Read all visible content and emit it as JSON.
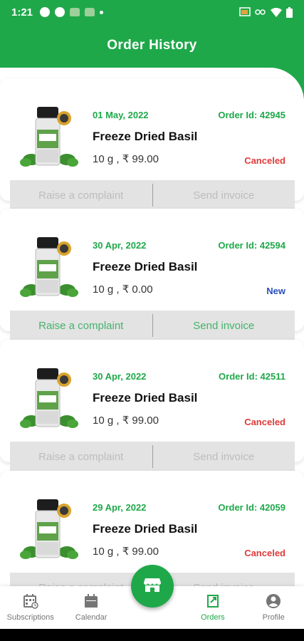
{
  "status_bar": {
    "time": "1:21",
    "left_icons": [
      "chrome-icon",
      "play-icon",
      "android-icon",
      "android-icon",
      "dot-icon"
    ],
    "right_icons": [
      "cast-icon",
      "vpn-key-icon",
      "wifi-icon",
      "battery-icon"
    ]
  },
  "header": {
    "title": "Order History"
  },
  "orders": [
    {
      "date": "01 May, 2022",
      "order_id": "Order Id: 42945",
      "product": "Freeze Dried Basil",
      "price": "10 g , ₹ 99.00",
      "status": "Canceled",
      "status_color": "#e03a3a",
      "complaint_label": "Raise a complaint",
      "invoice_label": "Send invoice",
      "actions_enabled": false
    },
    {
      "date": "30 Apr, 2022",
      "order_id": "Order Id: 42594",
      "product": "Freeze Dried Basil",
      "price": "10 g , ₹ 0.00",
      "status": "New",
      "status_color": "#2a4fbf",
      "complaint_label": "Raise a complaint",
      "invoice_label": "Send invoice",
      "actions_enabled": true
    },
    {
      "date": "30 Apr, 2022",
      "order_id": "Order Id: 42511",
      "product": "Freeze Dried Basil",
      "price": "10 g , ₹ 99.00",
      "status": "Canceled",
      "status_color": "#e03a3a",
      "complaint_label": "Raise a complaint",
      "invoice_label": "Send invoice",
      "actions_enabled": false
    },
    {
      "date": "29 Apr, 2022",
      "order_id": "Order Id: 42059",
      "product": "Freeze Dried Basil",
      "price": "10 g , ₹ 99.00",
      "status": "Canceled",
      "status_color": "#e03a3a",
      "complaint_label": "Raise a complaint",
      "invoice_label": "Send invoice",
      "actions_enabled": false
    }
  ],
  "bottom_nav": {
    "items": [
      {
        "label": "Subscriptions",
        "icon": "subscriptions-icon",
        "active": false
      },
      {
        "label": "Calendar",
        "icon": "calendar-icon",
        "active": false
      },
      {
        "label": "Orders",
        "icon": "orders-icon",
        "active": true
      },
      {
        "label": "Profile",
        "icon": "profile-icon",
        "active": false
      }
    ],
    "fab_icon": "store-icon"
  },
  "colors": {
    "brand_green": "#1fa84a",
    "canceled_red": "#e03a3a",
    "new_blue": "#2a4fbf"
  }
}
